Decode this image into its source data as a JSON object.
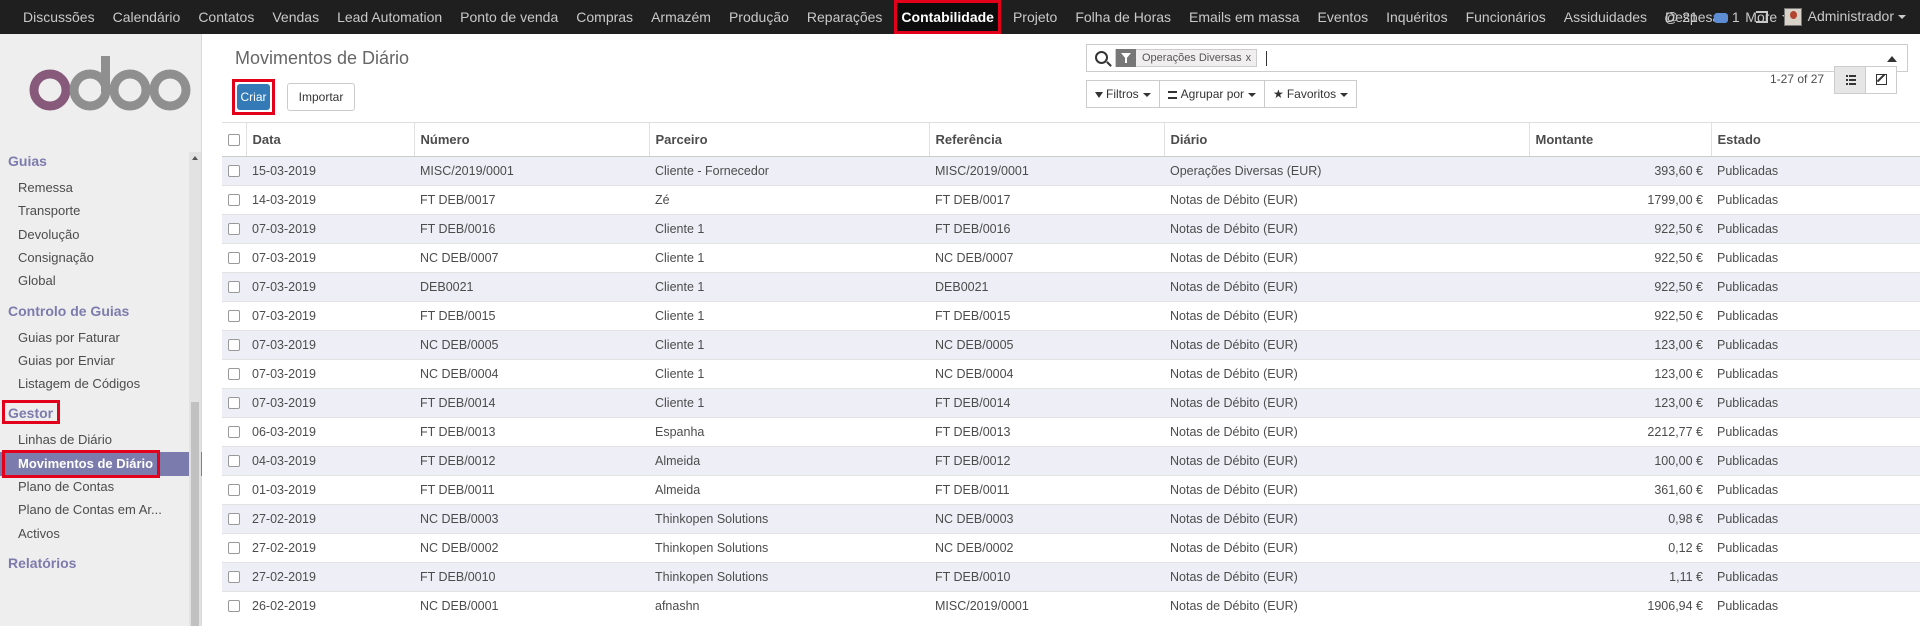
{
  "topbar": {
    "menu": [
      "Discussões",
      "Calendário",
      "Contatos",
      "Vendas",
      "Lead Automation",
      "Ponto de venda",
      "Compras",
      "Armazém",
      "Produção",
      "Reparações",
      "Contabilidade",
      "Projeto",
      "Folha de Horas",
      "Emails em massa",
      "Eventos",
      "Inquéritos",
      "Funcionários",
      "Assiduidades",
      "Despesas",
      "More"
    ],
    "active": "Contabilidade",
    "activity_count": "@ 21",
    "message_count": "1",
    "user": "Administrador"
  },
  "sidebar": {
    "sections": [
      {
        "title": "Guias",
        "items": [
          "Remessa",
          "Transporte",
          "Devolução",
          "Consignação",
          "Global"
        ]
      },
      {
        "title": "Controlo de Guias",
        "items": [
          "Guias por Faturar",
          "Guias por Enviar",
          "Listagem de Códigos"
        ]
      },
      {
        "title": "Gestor",
        "items": [
          "Linhas de Diário",
          "Movimentos de Diário",
          "Plano de Contas",
          "Plano de Contas em Ar...",
          "Activos"
        ]
      },
      {
        "title": "Relatórios",
        "items": []
      }
    ],
    "active_item": "Movimentos de Diário"
  },
  "control": {
    "breadcrumb": "Movimentos de Diário",
    "create_label": "Criar",
    "import_label": "Importar",
    "search_facet": "Operações Diversas",
    "search_facet_close": "x",
    "filters_label": "Filtros",
    "groupby_label": "Agrupar por",
    "favorites_label": "Favoritos",
    "pager": "1-27 of 27"
  },
  "table": {
    "columns": [
      "Data",
      "Número",
      "Parceiro",
      "Referência",
      "Diário",
      "Montante",
      "Estado"
    ],
    "rows": [
      [
        "15-03-2019",
        "MISC/2019/0001",
        "Cliente - Fornecedor",
        "MISC/2019/0001",
        "Operações Diversas (EUR)",
        "393,60 €",
        "Publicadas"
      ],
      [
        "14-03-2019",
        "FT DEB/0017",
        "Zé",
        "FT DEB/0017",
        "Notas de Débito (EUR)",
        "1799,00 €",
        "Publicadas"
      ],
      [
        "07-03-2019",
        "FT DEB/0016",
        "Cliente 1",
        "FT DEB/0016",
        "Notas de Débito (EUR)",
        "922,50 €",
        "Publicadas"
      ],
      [
        "07-03-2019",
        "NC DEB/0007",
        "Cliente 1",
        "NC DEB/0007",
        "Notas de Débito (EUR)",
        "922,50 €",
        "Publicadas"
      ],
      [
        "07-03-2019",
        "DEB0021",
        "Cliente 1",
        "DEB0021",
        "Notas de Débito (EUR)",
        "922,50 €",
        "Publicadas"
      ],
      [
        "07-03-2019",
        "FT DEB/0015",
        "Cliente 1",
        "FT DEB/0015",
        "Notas de Débito (EUR)",
        "922,50 €",
        "Publicadas"
      ],
      [
        "07-03-2019",
        "NC DEB/0005",
        "Cliente 1",
        "NC DEB/0005",
        "Notas de Débito (EUR)",
        "123,00 €",
        "Publicadas"
      ],
      [
        "07-03-2019",
        "NC DEB/0004",
        "Cliente 1",
        "NC DEB/0004",
        "Notas de Débito (EUR)",
        "123,00 €",
        "Publicadas"
      ],
      [
        "07-03-2019",
        "FT DEB/0014",
        "Cliente 1",
        "FT DEB/0014",
        "Notas de Débito (EUR)",
        "123,00 €",
        "Publicadas"
      ],
      [
        "06-03-2019",
        "FT DEB/0013",
        "Espanha",
        "FT DEB/0013",
        "Notas de Débito (EUR)",
        "2212,77 €",
        "Publicadas"
      ],
      [
        "04-03-2019",
        "FT DEB/0012",
        "Almeida",
        "FT DEB/0012",
        "Notas de Débito (EUR)",
        "100,00 €",
        "Publicadas"
      ],
      [
        "01-03-2019",
        "FT DEB/0011",
        "Almeida",
        "FT DEB/0011",
        "Notas de Débito (EUR)",
        "361,60 €",
        "Publicadas"
      ],
      [
        "27-02-2019",
        "NC DEB/0003",
        "Thinkopen Solutions",
        "NC DEB/0003",
        "Notas de Débito (EUR)",
        "0,98 €",
        "Publicadas"
      ],
      [
        "27-02-2019",
        "NC DEB/0002",
        "Thinkopen Solutions",
        "NC DEB/0002",
        "Notas de Débito (EUR)",
        "0,12 €",
        "Publicadas"
      ],
      [
        "27-02-2019",
        "FT DEB/0010",
        "Thinkopen Solutions",
        "FT DEB/0010",
        "Notas de Débito (EUR)",
        "1,11 €",
        "Publicadas"
      ],
      [
        "26-02-2019",
        "NC DEB/0001",
        "afnashn",
        "MISC/2019/0001",
        "Notas de Débito (EUR)",
        "1906,94 €",
        "Publicadas"
      ]
    ]
  },
  "colors": {
    "accent": "#7c7bad",
    "primary": "#337ab7",
    "highlight": "#e3001b"
  }
}
